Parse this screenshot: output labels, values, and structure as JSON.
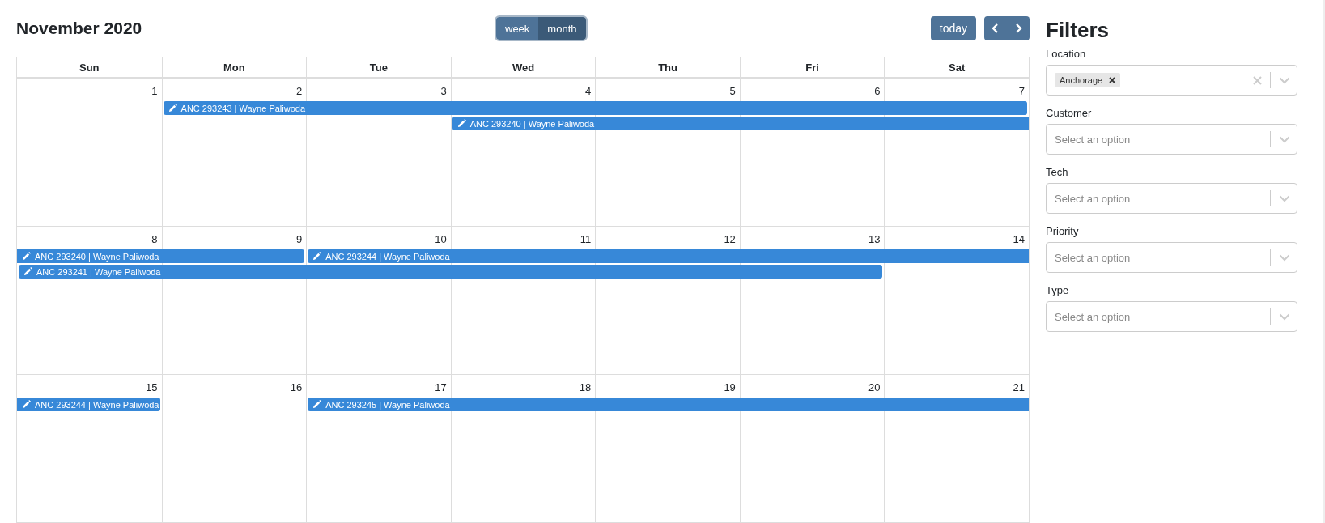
{
  "calendar": {
    "title": "November 2020",
    "views": [
      {
        "label": "week",
        "selected": false
      },
      {
        "label": "month",
        "selected": true
      }
    ],
    "today_button": "today",
    "weekdays": [
      "Sun",
      "Mon",
      "Tue",
      "Wed",
      "Thu",
      "Fri",
      "Sat"
    ],
    "weeks": [
      {
        "days": [
          "1",
          "2",
          "3",
          "4",
          "5",
          "6",
          "7"
        ],
        "lanes": [
          [
            {
              "kind": "empty"
            },
            {
              "kind": "event",
              "label": "ANC 293243 | Wayne Paliwoda",
              "continued_from_before": false,
              "continues_after": false
            },
            {
              "kind": "cont"
            },
            {
              "kind": "cont"
            },
            {
              "kind": "cont"
            },
            {
              "kind": "cont"
            },
            {
              "kind": "cont"
            }
          ],
          [
            {
              "kind": "empty"
            },
            {
              "kind": "empty"
            },
            {
              "kind": "empty"
            },
            {
              "kind": "event",
              "label": "ANC 293240 | Wayne Paliwoda",
              "continued_from_before": false,
              "continues_after": true
            },
            {
              "kind": "cont"
            },
            {
              "kind": "cont"
            },
            {
              "kind": "cont"
            }
          ]
        ]
      },
      {
        "days": [
          "8",
          "9",
          "10",
          "11",
          "12",
          "13",
          "14"
        ],
        "lanes": [
          [
            {
              "kind": "event",
              "label": "ANC 293240 | Wayne Paliwoda",
              "continued_from_before": true,
              "continues_after": false
            },
            {
              "kind": "cont"
            },
            {
              "kind": "event",
              "label": "ANC 293244 | Wayne Paliwoda",
              "continued_from_before": false,
              "continues_after": true
            },
            {
              "kind": "cont"
            },
            {
              "kind": "cont"
            },
            {
              "kind": "cont"
            },
            {
              "kind": "cont"
            }
          ],
          [
            {
              "kind": "event",
              "label": "ANC 293241 | Wayne Paliwoda",
              "continued_from_before": false,
              "continues_after": false
            },
            {
              "kind": "cont"
            },
            {
              "kind": "cont"
            },
            {
              "kind": "cont"
            },
            {
              "kind": "cont"
            },
            {
              "kind": "cont"
            },
            {
              "kind": "empty"
            }
          ]
        ]
      },
      {
        "days": [
          "15",
          "16",
          "17",
          "18",
          "19",
          "20",
          "21"
        ],
        "lanes": [
          [
            {
              "kind": "event",
              "label": "ANC 293244 | Wayne Paliwoda",
              "continued_from_before": true,
              "continues_after": false
            },
            {
              "kind": "empty"
            },
            {
              "kind": "event",
              "label": "ANC 293245 | Wayne Paliwoda",
              "continued_from_before": false,
              "continues_after": true
            },
            {
              "kind": "cont"
            },
            {
              "kind": "cont"
            },
            {
              "kind": "cont"
            },
            {
              "kind": "cont"
            }
          ]
        ]
      }
    ]
  },
  "filters": {
    "title": "Filters",
    "fields": [
      {
        "label": "Location",
        "tags": [
          "Anchorage"
        ]
      },
      {
        "label": "Customer",
        "placeholder": "Select an option"
      },
      {
        "label": "Tech",
        "placeholder": "Select an option"
      },
      {
        "label": "Priority",
        "placeholder": "Select an option"
      },
      {
        "label": "Type",
        "placeholder": "Select an option"
      }
    ]
  }
}
